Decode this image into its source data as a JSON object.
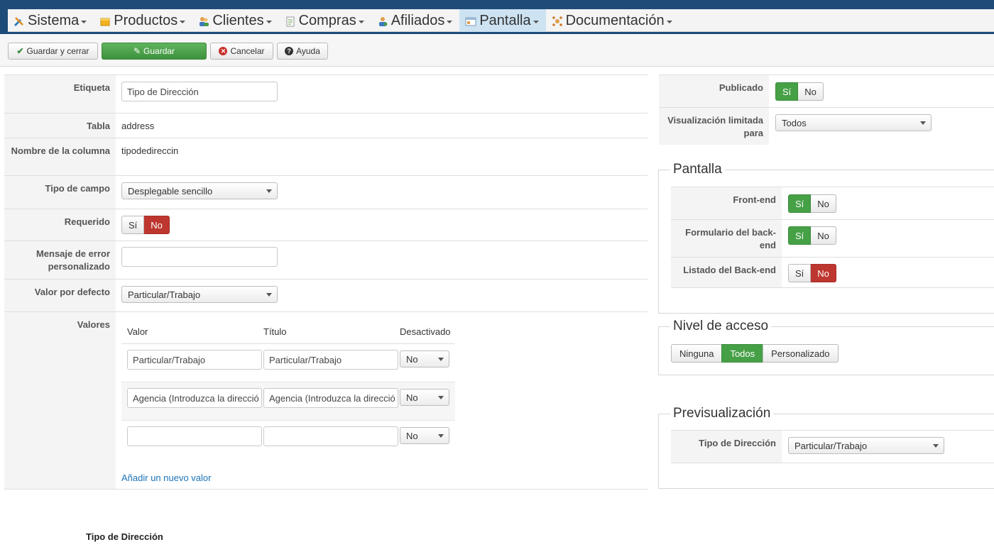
{
  "menu": {
    "items": [
      {
        "label": "Sistema",
        "icon": "tools-icon"
      },
      {
        "label": "Productos",
        "icon": "box-icon"
      },
      {
        "label": "Clientes",
        "icon": "users-icon"
      },
      {
        "label": "Compras",
        "icon": "orders-icon"
      },
      {
        "label": "Afiliados",
        "icon": "affiliate-icon"
      },
      {
        "label": "Pantalla",
        "icon": "display-icon",
        "active": true
      },
      {
        "label": "Documentación",
        "icon": "docs-icon"
      }
    ]
  },
  "toolbar": {
    "save_close": "Guardar y cerrar",
    "save": "Guardar",
    "cancel": "Cancelar",
    "help": "Ayuda"
  },
  "form": {
    "label_label": "Etiqueta",
    "label_value": "Tipo de Dirección",
    "table_label": "Tabla",
    "table_value": "address",
    "column_label": "Nombre de la columna",
    "column_value": "tipodedireccin",
    "fieldtype_label": "Tipo de campo",
    "fieldtype_value": "Desplegable sencillo",
    "required_label": "Requerido",
    "required_yes": "Sí",
    "required_no": "No",
    "required_value": "No",
    "errmsg_label": "Mensaje de error personalizado",
    "errmsg_value": "",
    "default_label": "Valor por defecto",
    "default_value": "Particular/Trabajo",
    "values_label": "Valores",
    "values_header": {
      "value": "Valor",
      "title": "Título",
      "disabled": "Desactivado"
    },
    "values_rows": [
      {
        "value": "Particular/Trabajo",
        "title": "Particular/Trabajo",
        "disabled": "No"
      },
      {
        "value": "Agencia (Introduzca la direcció",
        "title": "Agencia (Introduzca la direcció",
        "disabled": "No"
      },
      {
        "value": "",
        "title": "",
        "disabled": "No"
      }
    ],
    "add_value": "Añadir un nuevo valor"
  },
  "right": {
    "published_label": "Publicado",
    "published_yes": "Sí",
    "published_no": "No",
    "published_value": "Sí",
    "limited_label": "Visualización limitada para",
    "limited_value": "Todos",
    "pantalla_legend": "Pantalla",
    "frontend_label": "Front-end",
    "frontend_value": "Sí",
    "backend_form_label": "Formulario del back-end",
    "backend_form_value": "Sí",
    "backend_list_label": "Listado del Back-end",
    "backend_list_value": "No",
    "yes": "Sí",
    "no": "No",
    "access_legend": "Nivel de acceso",
    "access_options": [
      "Ninguna",
      "Todos",
      "Personalizado"
    ],
    "access_value": "Todos",
    "preview_legend": "Previsualización",
    "preview_field_label": "Tipo de Dirección",
    "preview_field_value": "Particular/Trabajo"
  },
  "preview_bottom_label": "Tipo de Dirección",
  "colors": {
    "header_bg": "#1f4b78",
    "green": "#46a046",
    "red": "#bd362f",
    "link": "#1a73b8"
  }
}
